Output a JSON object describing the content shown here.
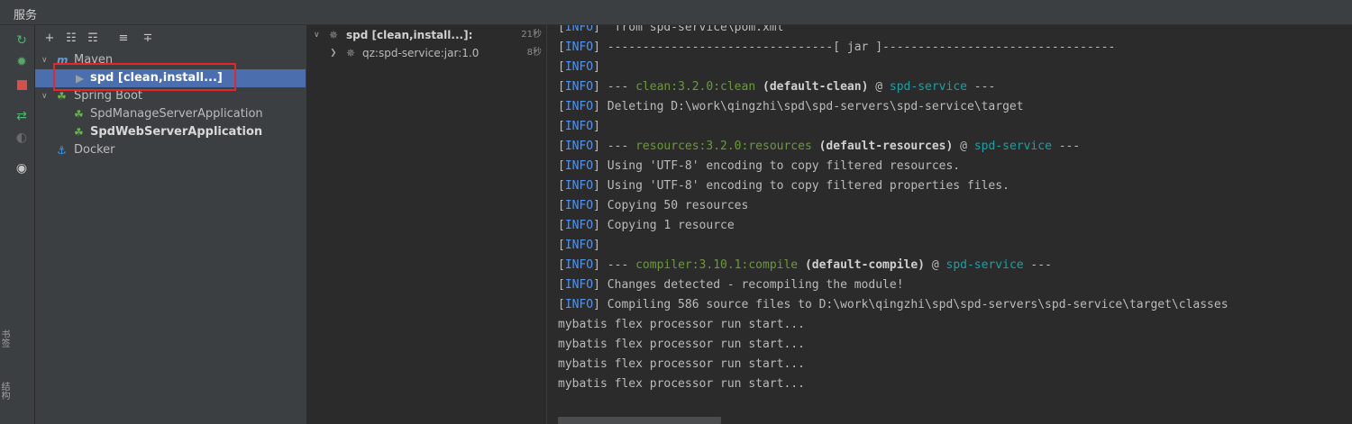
{
  "window": {
    "title": "服务"
  },
  "side_tabs": [
    "书签",
    "结构"
  ],
  "toolbar": {
    "rerun_icon": "rerun-icon",
    "debug_icon": "debug-icon",
    "stop_icon": "stop-icon",
    "toggle_icon": "toggle-icon",
    "profile_icon": "profile-icon",
    "eye_icon": "eye-icon"
  },
  "tree": {
    "items": [
      {
        "label": "Maven"
      },
      {
        "label": "spd [clean,install...]"
      },
      {
        "label": "Spring Boot"
      },
      {
        "label": "SpdManageServerApplication"
      },
      {
        "label": "SpdWebServerApplication"
      },
      {
        "label": "Docker"
      }
    ]
  },
  "build": {
    "items": [
      {
        "label": "spd [clean,install...]:",
        "time": "21秒"
      },
      {
        "label": "qz:spd-service:jar:1.0",
        "time": "8秒"
      }
    ]
  },
  "console": {
    "tag": "INFO",
    "lines": [
      {
        "rest": "  from spd-service\\pom.xml"
      },
      {
        "rest": " --------------------------------[ jar ]---------------------------------"
      },
      {
        "rest": ""
      },
      {
        "pre": " --- ",
        "plugin": "clean:3.2.0:clean",
        "exec": " (default-clean)",
        "at": " @ ",
        "module": "spd-service",
        "post": " ---"
      },
      {
        "rest": " Deleting D:\\work\\qingzhi\\spd\\spd-servers\\spd-service\\target"
      },
      {
        "rest": ""
      },
      {
        "pre": " --- ",
        "plugin": "resources:3.2.0:resources",
        "exec": " (default-resources)",
        "at": " @ ",
        "module": "spd-service",
        "post": " ---"
      },
      {
        "rest": " Using 'UTF-8' encoding to copy filtered resources."
      },
      {
        "rest": " Using 'UTF-8' encoding to copy filtered properties files."
      },
      {
        "rest": " Copying 50 resources"
      },
      {
        "rest": " Copying 1 resource"
      },
      {
        "rest": ""
      },
      {
        "pre": " --- ",
        "plugin": "compiler:3.10.1:compile",
        "exec": " (default-compile)",
        "at": " @ ",
        "module": "spd-service",
        "post": " ---"
      },
      {
        "rest": " Changes detected - recompiling the module!"
      },
      {
        "rest": " Compiling 586 source files to D:\\work\\qingzhi\\spd\\spd-servers\\spd-service\\target\\classes"
      }
    ],
    "plain_lines": [
      "mybatis flex processor run start...",
      "mybatis flex processor run start...",
      "mybatis flex processor run start...",
      "mybatis flex processor run start..."
    ]
  },
  "colors": {
    "accent_selection": "#4b6eaf",
    "info_tag": "#5394ec",
    "plugin_green": "#6a9a39",
    "module_teal": "#16a2a6",
    "highlight_red": "#e8252b"
  }
}
